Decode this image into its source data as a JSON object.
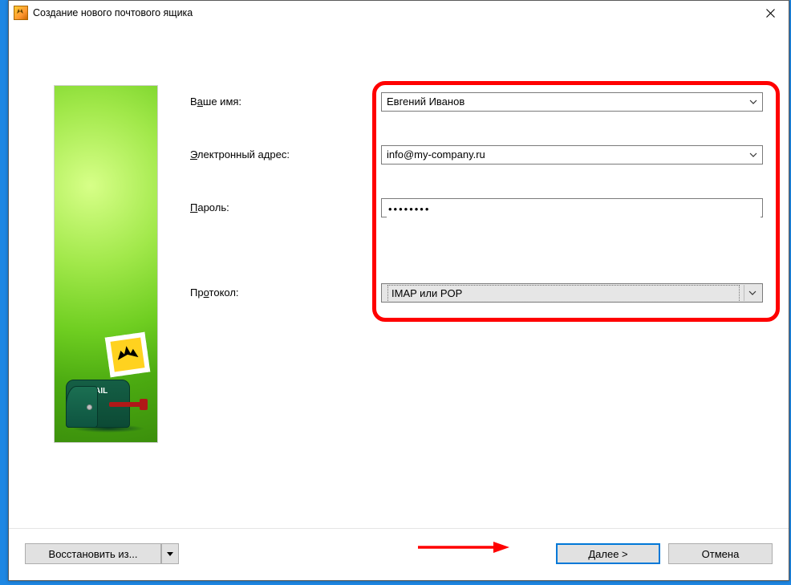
{
  "window": {
    "title": "Создание нового почтового ящика"
  },
  "form": {
    "name": {
      "label_pre": "В",
      "label_accel": "а",
      "label_post": "ше имя:",
      "value": "Евгений Иванов"
    },
    "email": {
      "label_pre": "",
      "label_accel": "Э",
      "label_post": "лектронный адрес:",
      "value": "info@my-company.ru"
    },
    "pass": {
      "label_pre": "",
      "label_accel": "П",
      "label_post": "ароль:",
      "value": "••••••••"
    },
    "proto": {
      "label_pre": "Пр",
      "label_accel": "о",
      "label_post": "токол:",
      "value": "IMAP или POP"
    }
  },
  "footer": {
    "restore": "Восстановить из...",
    "next": "Далее   >",
    "cancel": "Отмена"
  }
}
